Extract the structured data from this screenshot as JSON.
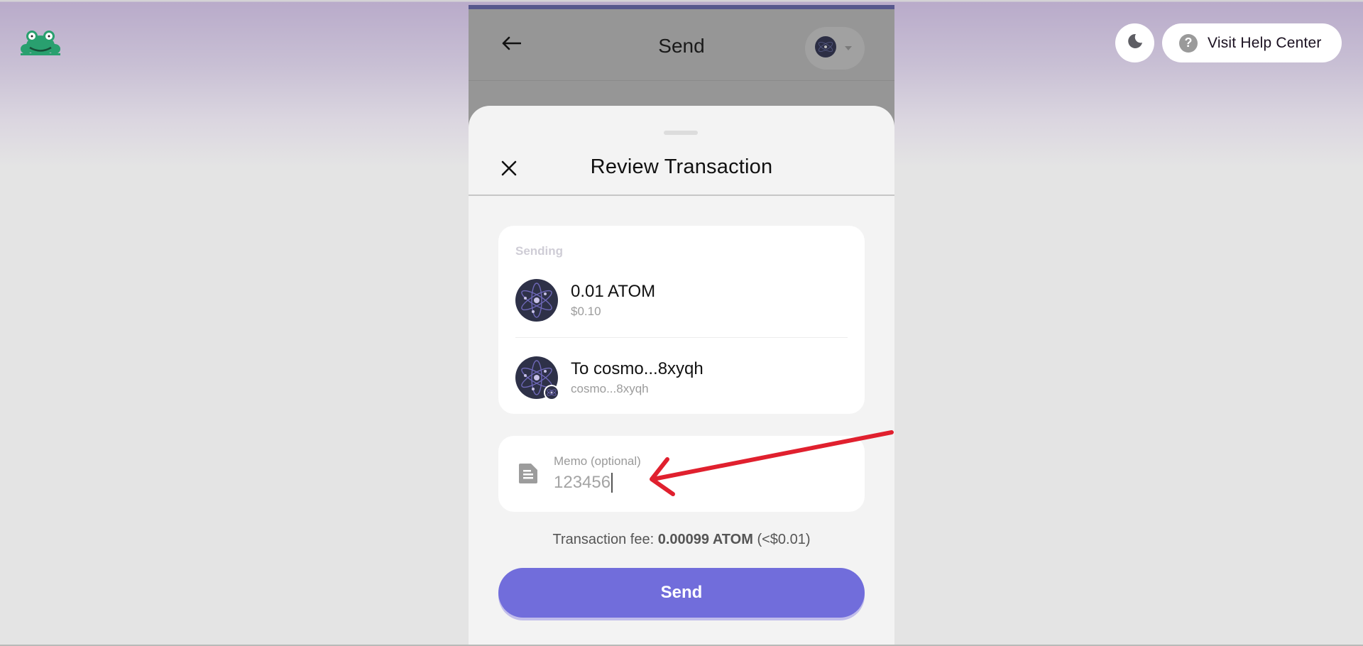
{
  "page": {
    "logo_icon": "frog-logo-icon",
    "theme_toggle": {
      "icon": "moon-icon"
    },
    "help_button": {
      "icon": "question-circle-icon",
      "label": "Visit Help Center"
    }
  },
  "wallet": {
    "header": {
      "back_icon": "arrow-left-icon",
      "title": "Send",
      "chain_selector": {
        "icon": "cosmos-atom-icon",
        "caret": "caret-down-icon"
      }
    },
    "review_sheet": {
      "close_icon": "close-x-icon",
      "title": "Review Transaction",
      "sending_card": {
        "section_label": "Sending",
        "asset": {
          "icon": "cosmos-atom-icon",
          "amount": "0.01 ATOM",
          "fiat_value": "$0.10"
        },
        "recipient": {
          "icon": "cosmos-atom-icon",
          "title": "To cosmo...8xyqh",
          "address": "cosmo...8xyqh"
        }
      },
      "memo": {
        "icon": "document-icon",
        "label": "Memo (optional)",
        "value": "123456"
      },
      "fee": {
        "label": "Transaction fee:",
        "amount": "0.00099 ATOM",
        "fiat": "(<$0.01)"
      },
      "send_button_label": "Send"
    }
  },
  "annotation": {
    "type": "red-arrow",
    "color": "#e0202e",
    "points_to": "memo-input"
  },
  "colors": {
    "accent": "#716ddb",
    "topbar": "#56578c",
    "cosmos_icon_bg": "#2e3148",
    "cosmos_orbit": "#7a72c9"
  }
}
